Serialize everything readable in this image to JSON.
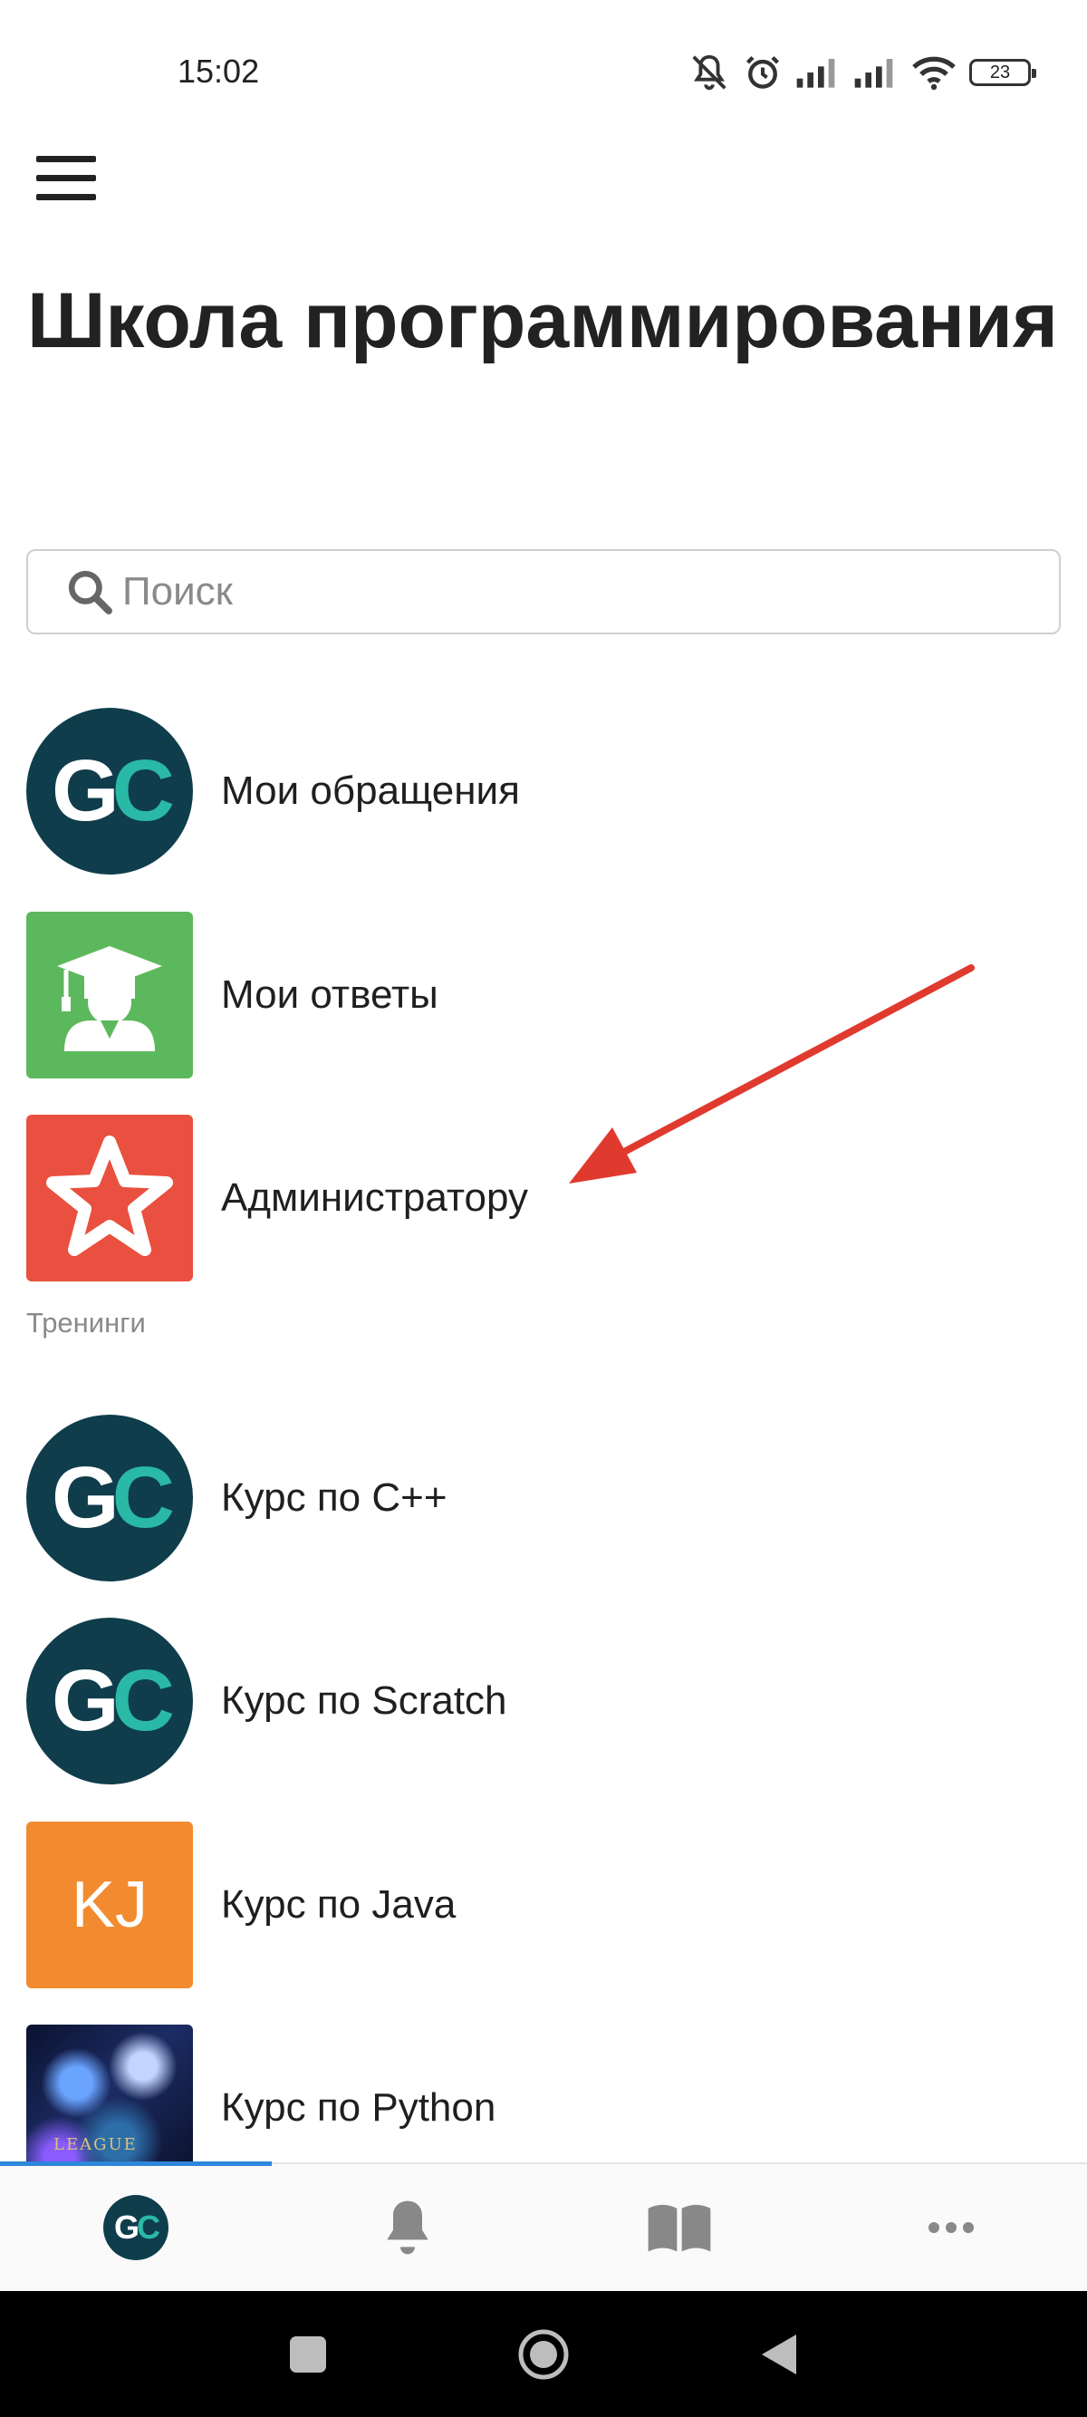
{
  "status_bar": {
    "time": "15:02",
    "battery": "23",
    "icons": [
      "bell-off-icon",
      "alarm-icon",
      "signal-icon",
      "signal-icon",
      "wifi-icon",
      "battery-icon"
    ]
  },
  "header": {
    "menu_icon": "hamburger-menu-icon",
    "title": "Школа программирования"
  },
  "search": {
    "placeholder": "Поиск",
    "value": ""
  },
  "list": {
    "items": [
      {
        "label": "Мои обращения",
        "icon": "gc-logo"
      },
      {
        "label": "Мои ответы",
        "icon": "graduate-icon"
      },
      {
        "label": "Администратору",
        "icon": "star-icon"
      }
    ],
    "section_label": "Тренинги",
    "courses": [
      {
        "label": "Курс по C++",
        "icon": "gc-logo"
      },
      {
        "label": "Курс по Scratch",
        "icon": "gc-logo"
      },
      {
        "label": "Курс по Java",
        "icon": "initials-avatar",
        "initials": "KJ"
      },
      {
        "label": "Курс по Python",
        "icon": "game-artwork"
      }
    ]
  },
  "logo": {
    "g": "G",
    "c": "C"
  },
  "tab_bar": {
    "tabs": [
      "home-gc-logo",
      "bell-icon",
      "book-icon",
      "more-icon"
    ],
    "active_index": 0
  },
  "nav_bar": {
    "buttons": [
      "recents-square-icon",
      "home-circle-icon",
      "back-triangle-icon"
    ]
  },
  "colors": {
    "gc_dark": "#0f3d4c",
    "gc_teal": "#2ab9a7",
    "green": "#5cb85c",
    "red": "#e9503f",
    "orange": "#f28b30",
    "accent_blue": "#2d86d9",
    "annotation_arrow": "#e03a2f"
  }
}
